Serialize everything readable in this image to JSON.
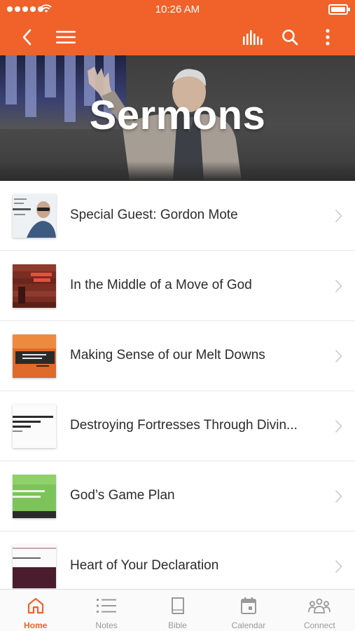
{
  "status_bar": {
    "time": "10:26 AM",
    "battery_level": 1.0
  },
  "nav": {
    "icons": [
      "back-icon",
      "menu-icon",
      "audio-icon",
      "search-icon",
      "more-icon"
    ]
  },
  "hero": {
    "title": "Sermons"
  },
  "sermons": [
    {
      "title": "Special Guest: Gordon Mote"
    },
    {
      "title": "In the Middle of a Move of God"
    },
    {
      "title": "Making Sense of our Melt Downs"
    },
    {
      "title": "Destroying Fortresses Through Divin..."
    },
    {
      "title": "God’s Game Plan"
    },
    {
      "title": "Heart of Your Declaration"
    }
  ],
  "tabs": [
    {
      "label": "Home",
      "icon": "home-icon",
      "active": true
    },
    {
      "label": "Notes",
      "icon": "notes-icon",
      "active": false
    },
    {
      "label": "Bible",
      "icon": "bible-icon",
      "active": false
    },
    {
      "label": "Calendar",
      "icon": "calendar-icon",
      "active": false
    },
    {
      "label": "Connect",
      "icon": "connect-icon",
      "active": false
    }
  ],
  "colors": {
    "accent": "#f0622a",
    "tab_inactive": "#999999",
    "text": "#2c2c2c"
  }
}
